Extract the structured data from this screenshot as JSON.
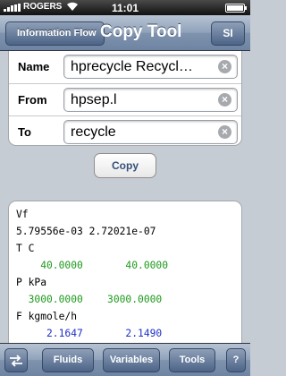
{
  "status_bar": {
    "carrier": "ROGERS",
    "time": "11:01",
    "battery_level": 1.0
  },
  "nav": {
    "back_label": "Information Flow",
    "title": "Copy Tool",
    "unit_label": "SI"
  },
  "form": {
    "name_label": "Name",
    "name_value": "hprecycle Recycl…",
    "from_label": "From",
    "from_value": "hpsep.l",
    "to_label": "To",
    "to_value": "recycle"
  },
  "copy_button_label": "Copy",
  "output": {
    "lines": [
      {
        "text": "Vf",
        "color": "#000000"
      },
      {
        "text": "5.79556e-03 2.72021e-07",
        "color": "#000000"
      },
      {
        "text": "T C",
        "color": "#000000"
      },
      {
        "text": "    40.0000       40.0000",
        "color": "#1d9a1d"
      },
      {
        "text": "P kPa",
        "color": "#000000"
      },
      {
        "text": "  3000.0000    3000.0000",
        "color": "#1d9a1d"
      },
      {
        "text": "F kgmole/h",
        "color": "#000000"
      },
      {
        "text": "     2.1647       2.1490",
        "color": "#1e30c8"
      }
    ]
  },
  "toolbar": {
    "swap_icon": "swap-arrows-icon",
    "fluids_label": "Fluids",
    "variables_label": "Variables",
    "tools_label": "Tools",
    "help_label": "?"
  }
}
